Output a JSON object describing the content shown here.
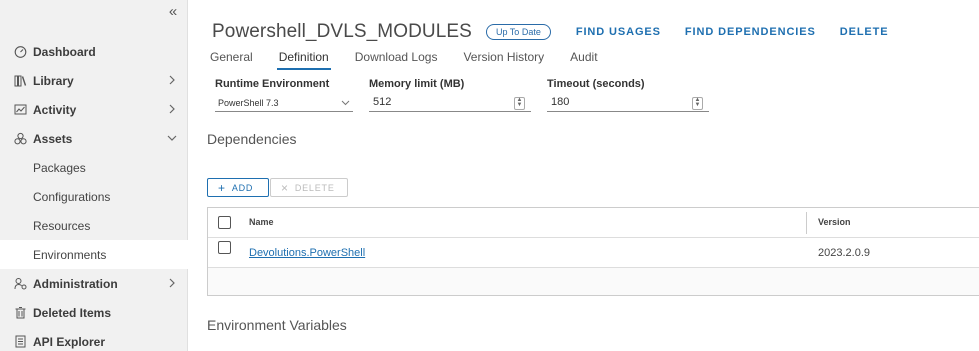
{
  "sidebar": {
    "collapse_glyph": "«",
    "items": [
      {
        "label": "Dashboard",
        "icon": "dashboard-icon"
      },
      {
        "label": "Library",
        "icon": "library-icon"
      },
      {
        "label": "Activity",
        "icon": "activity-icon"
      },
      {
        "label": "Assets",
        "icon": "assets-icon"
      },
      {
        "label": "Packages"
      },
      {
        "label": "Configurations"
      },
      {
        "label": "Resources"
      },
      {
        "label": "Environments"
      },
      {
        "label": "Administration",
        "icon": "administration-icon"
      },
      {
        "label": "Deleted Items",
        "icon": "trash-icon"
      },
      {
        "label": "API Explorer",
        "icon": "api-explorer-icon"
      }
    ]
  },
  "header": {
    "title": "Powershell_DVLS_MODULES",
    "status_badge": "Up To Date",
    "actions": [
      "FIND USAGES",
      "FIND DEPENDENCIES",
      "DELETE"
    ]
  },
  "tabs": [
    "General",
    "Definition",
    "Download Logs",
    "Version History",
    "Audit"
  ],
  "form": {
    "runtime": {
      "label": "Runtime Environment",
      "value": "PowerShell 7.3"
    },
    "memory": {
      "label": "Memory limit (MB)",
      "value": "512"
    },
    "timeout": {
      "label": "Timeout (seconds)",
      "value": "180"
    }
  },
  "dependencies": {
    "section_title": "Dependencies",
    "add_label": "ADD",
    "delete_label": "DELETE",
    "columns": [
      "Name",
      "Version"
    ],
    "rows": [
      {
        "name": "Devolutions.PowerShell",
        "version": "2023.2.0.9"
      }
    ]
  },
  "env_vars": {
    "section_title": "Environment Variables"
  },
  "colors": {
    "accent": "#1e6fb0",
    "sidebar_bg": "#f1f1f1"
  }
}
